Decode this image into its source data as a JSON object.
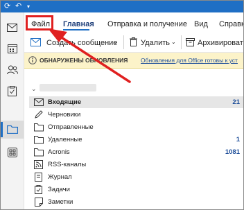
{
  "ribbon": {
    "tabs": [
      {
        "label": "Файл"
      },
      {
        "label": "Главная"
      },
      {
        "label": "Отправка и получение"
      },
      {
        "label": "Вид"
      },
      {
        "label": "Справка"
      }
    ],
    "active_tab": "Главная"
  },
  "toolbar": {
    "create_message": "Создать сообщение",
    "delete": "Удалить",
    "archive": "Архивировать"
  },
  "infobar": {
    "title": "ОБНАРУЖЕНЫ ОБНОВЛЕНИЯ",
    "link": "Обновления для Office готовы к уст"
  },
  "folders": [
    {
      "label": "Входящие",
      "count": "21",
      "selected": true,
      "icon": "inbox-icon"
    },
    {
      "label": "Черновики",
      "count": "",
      "icon": "drafts-icon"
    },
    {
      "label": "Отправленные",
      "count": "",
      "icon": "folder-icon"
    },
    {
      "label": "Удаленные",
      "count": "1",
      "icon": "folder-icon"
    },
    {
      "label": "Acronis",
      "count": "1081",
      "icon": "folder-icon"
    },
    {
      "label": "RSS-каналы",
      "count": "",
      "icon": "rss-icon"
    },
    {
      "label": "Журнал",
      "count": "",
      "icon": "journal-icon"
    },
    {
      "label": "Задачи",
      "count": "",
      "icon": "tasks-icon"
    },
    {
      "label": "Заметки",
      "count": "",
      "icon": "notes-icon"
    }
  ],
  "colors": {
    "accent": "#1f6fc5",
    "highlight": "#e02020",
    "info_bg": "#fcf3c9"
  }
}
